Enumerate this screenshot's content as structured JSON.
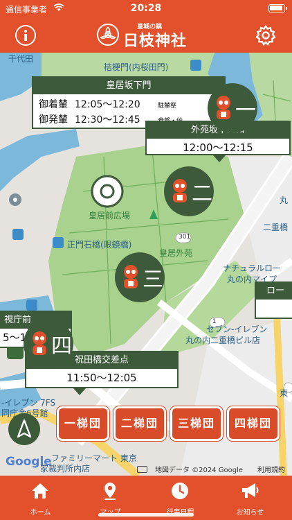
{
  "status_bar": {
    "carrier": "通信事業者",
    "time": "20:28"
  },
  "header": {
    "logo_sub": "皇城の鎮",
    "logo_main": "日枝神社"
  },
  "map": {
    "labels": {
      "chiyoda": "千代田",
      "kikyomon": "桔梗門(内桜田門)",
      "kokyomae": "皇居前広場",
      "seimon": "正門石橋(眼鏡橋)",
      "road301": "301",
      "gaien": "皇居外苑",
      "maru": "丸",
      "nijubashi": "二重橋",
      "natural1": "ナチュラルロー",
      "natural2": "丸の内マイプ",
      "lawson": "ロー",
      "seven1": "セブン-イレブン",
      "seven2": "丸の内二重橋ビル店",
      "road1": "1",
      "higashi": "東",
      "seven3": "-イレブン 7FS",
      "seven4": "同庁舎6号館",
      "family1": "ファミリーマート 東京",
      "family2": "家裁判所内店",
      "sofficed": "視庁前"
    },
    "cards": {
      "sakashita": {
        "title": "皇居坂下門",
        "rows": [
          {
            "label": "御着輦",
            "time": "12:05〜12:20",
            "note": "駐輦祭"
          },
          {
            "label": "御発輦",
            "time": "12:30〜12:45",
            "note": "参賀・納"
          }
        ]
      },
      "gaien": {
        "title": "外苑坂下門口",
        "time": "12:00〜12:15"
      },
      "iwaibashi": {
        "title": "祝田橋交差点",
        "time": "11:50〜12:05"
      },
      "shichomae_time": "5〜1"
    },
    "markers": {
      "m1": "一",
      "m2": "二",
      "m3": "三",
      "m4": "四"
    },
    "troupes": [
      "一梯団",
      "二梯団",
      "三梯団",
      "四梯団"
    ],
    "attribution": {
      "google": "Google",
      "data": "地図データ ©2024 Google",
      "terms": "利用規約"
    }
  },
  "tabs": [
    {
      "label": "ホーム",
      "icon": "home-icon"
    },
    {
      "label": "マップ",
      "icon": "map-pin-icon"
    },
    {
      "label": "行事日程",
      "icon": "clock-icon"
    },
    {
      "label": "お知らせ",
      "icon": "megaphone-icon"
    }
  ],
  "colors": {
    "brand": "#e2512b",
    "marker": "#3d5a3b",
    "moat": "#7bb8d9",
    "park": "#b9d9a3"
  }
}
